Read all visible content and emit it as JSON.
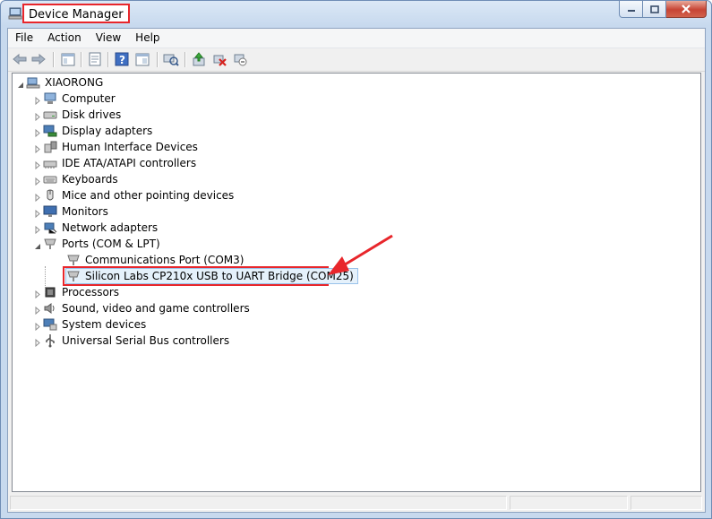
{
  "window": {
    "title": "Device Manager"
  },
  "menu": [
    "File",
    "Action",
    "View",
    "Help"
  ],
  "toolbar_icons": [
    "back-arrow-icon",
    "forward-arrow-icon",
    "show-hide-tree-icon",
    "properties-icon",
    "help-icon",
    "view-icon",
    "scan-hardware-icon",
    "update-driver-icon",
    "uninstall-icon",
    "disable-device-icon"
  ],
  "tree": {
    "root": "XIAORONG",
    "categories": [
      {
        "label": "Computer",
        "icon": "computer-icon",
        "expanded": false
      },
      {
        "label": "Disk drives",
        "icon": "disk-drive-icon",
        "expanded": false
      },
      {
        "label": "Display adapters",
        "icon": "display-adapter-icon",
        "expanded": false
      },
      {
        "label": "Human Interface Devices",
        "icon": "hid-icon",
        "expanded": false
      },
      {
        "label": "IDE ATA/ATAPI controllers",
        "icon": "ide-controller-icon",
        "expanded": false
      },
      {
        "label": "Keyboards",
        "icon": "keyboard-icon",
        "expanded": false
      },
      {
        "label": "Mice and other pointing devices",
        "icon": "mouse-icon",
        "expanded": false
      },
      {
        "label": "Monitors",
        "icon": "monitor-icon",
        "expanded": false
      },
      {
        "label": "Network adapters",
        "icon": "network-adapter-icon",
        "expanded": false
      },
      {
        "label": "Ports (COM & LPT)",
        "icon": "port-icon",
        "expanded": true,
        "children": [
          {
            "label": "Communications Port (COM3)",
            "icon": "port-icon"
          },
          {
            "label": "Silicon Labs CP210x USB to UART Bridge (COM25)",
            "icon": "port-icon",
            "selected": true
          }
        ]
      },
      {
        "label": "Processors",
        "icon": "processor-icon",
        "expanded": false
      },
      {
        "label": "Sound, video and game controllers",
        "icon": "sound-icon",
        "expanded": false
      },
      {
        "label": "System devices",
        "icon": "system-devices-icon",
        "expanded": false
      },
      {
        "label": "Universal Serial Bus controllers",
        "icon": "usb-icon",
        "expanded": false
      }
    ]
  },
  "colors": {
    "highlight_border": "#e8262b",
    "selection_fill": "#e5f1fb"
  }
}
